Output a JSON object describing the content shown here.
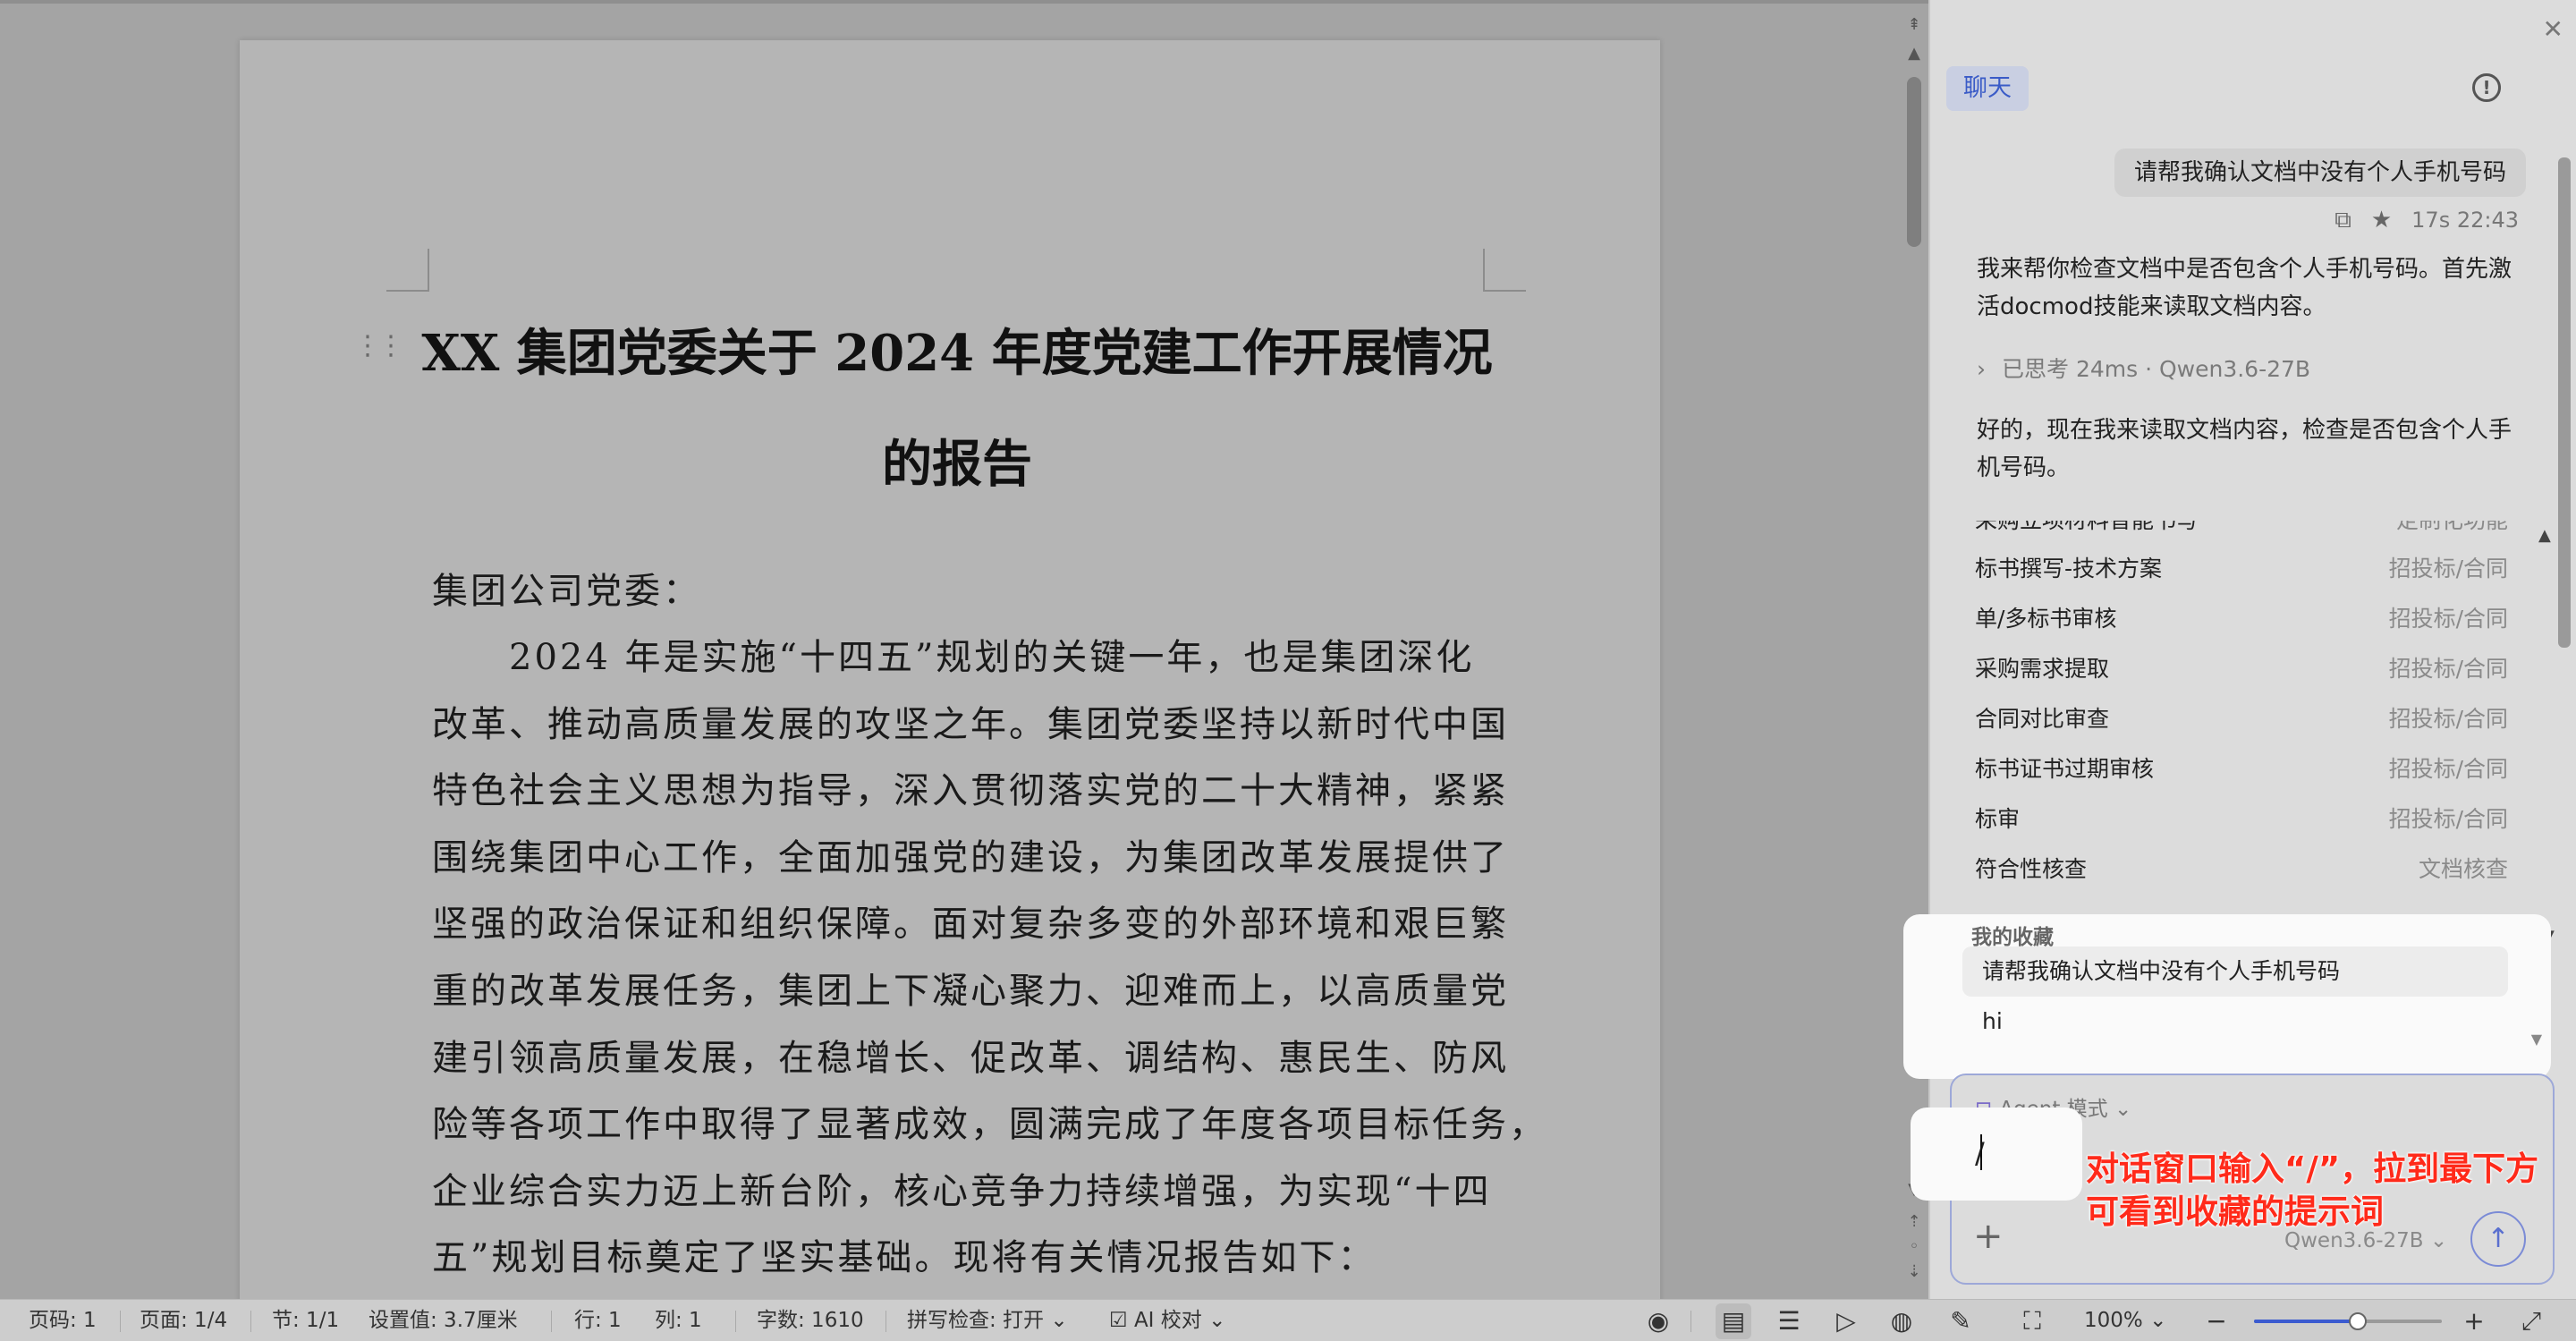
{
  "document": {
    "title_line1": "XX 集团党委关于 2024 年度党建工作开展情况",
    "title_line2": "的报告",
    "lines": [
      "集团公司党委：",
      "　　2024 年是实施“十四五”规划的关键一年，也是集团深化",
      "改革、推动高质量发展的攻坚之年。集团党委坚持以新时代中国",
      "特色社会主义思想为指导，深入贯彻落实党的二十大精神，紧紧",
      "围绕集团中心工作，全面加强党的建设，为集团改革发展提供了",
      "坚强的政治保证和组织保障。面对复杂多变的外部环境和艰巨繁",
      "重的改革发展任务，集团上下凝心聚力、迎难而上，以高质量党",
      "建引领高质量发展，在稳增长、促改革、调结构、惠民生、防风",
      "险等各项工作中取得了显著成效，圆满完成了年度各项目标任务，",
      "企业综合实力迈上新台阶，核心竞争力持续增强，为实现“十四",
      "五”规划目标奠定了坚实基础。现将有关情况报告如下："
    ]
  },
  "chat": {
    "tab_label": "聊天",
    "user_message": "请帮我确认文档中没有个人手机号码",
    "message_meta": "17s 22:43",
    "ai_message_1": "我来帮你检查文档中是否包含个人手机号码。首先激活docmod技能来读取文档内容。",
    "thinking_label": "已思考 24ms · Qwen3.6-27B",
    "ai_message_2": "好的，现在我来读取文档内容，检查是否包含个人手机号码。",
    "skills": [
      {
        "name": "采购立项材料智能书写",
        "category": "定制化功能"
      },
      {
        "name": "标书撰写-技术方案",
        "category": "招投标/合同"
      },
      {
        "name": "单/多标书审核",
        "category": "招投标/合同"
      },
      {
        "name": "采购需求提取",
        "category": "招投标/合同"
      },
      {
        "name": "合同对比审查",
        "category": "招投标/合同"
      },
      {
        "name": "标书证书过期审核",
        "category": "招投标/合同"
      },
      {
        "name": "标审",
        "category": "招投标/合同"
      },
      {
        "name": "符合性核查",
        "category": "文档核查"
      }
    ],
    "favorites_title": "我的收藏",
    "favorites": [
      "请帮我确认文档中没有个人手机号码",
      "hi"
    ],
    "input": {
      "mode_label": "Agent 模式",
      "value": "/",
      "model": "Qwen3.6-27B"
    },
    "annotation_line1": "对话窗口输入“/”，拉到最下方",
    "annotation_line2": "可看到收藏的提示词"
  },
  "status_bar": {
    "page_no": "页码: 1",
    "pages": "页面: 1/4",
    "section": "节: 1/1",
    "setting": "设置值: 3.7厘米",
    "row": "行: 1",
    "col": "列: 1",
    "word_count": "字数: 1610",
    "spell_check": "拼写检查: 打开",
    "ai_proof": "AI 校对",
    "zoom": "100%",
    "zoom_level": 0.55
  },
  "colors": {
    "accent": "#3b5bd0",
    "annotation": "#ff2a1a",
    "tab_active_bg": "#c9cfe2"
  }
}
